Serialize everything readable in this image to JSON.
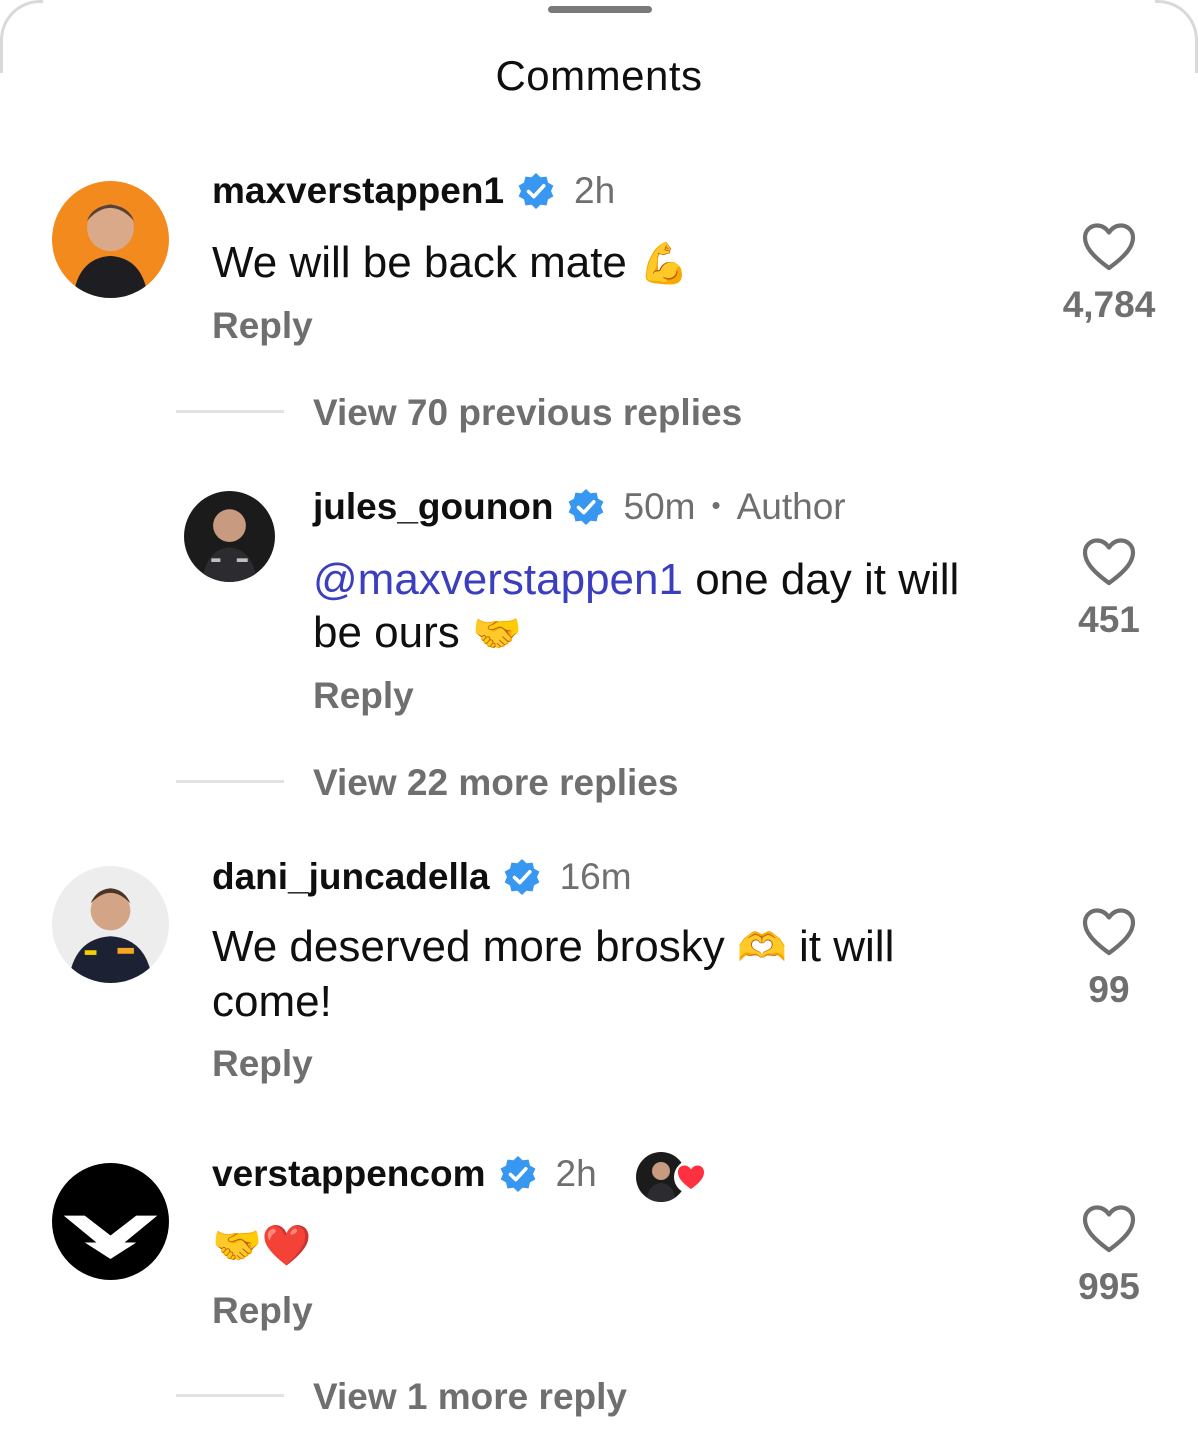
{
  "sheet": {
    "title": "Comments"
  },
  "comments": [
    {
      "username": "maxverstappen1",
      "time": "2h",
      "text": "We will be back mate",
      "emoji": "💪",
      "reply_label": "Reply",
      "likes": "4,784"
    },
    {
      "username": "jules_gounon",
      "time": "50m",
      "separator": "•",
      "author_tag": "Author",
      "mention": "@maxverstappen1",
      "text": "one day it will be ours",
      "emoji": "🤝",
      "reply_label": "Reply",
      "likes": "451"
    },
    {
      "username": "dani_juncadella",
      "time": "16m",
      "text_before": "We deserved more brosky",
      "emoji": "🫶",
      "text_after": "it will come!",
      "reply_label": "Reply",
      "likes": "99"
    },
    {
      "username": "verstappencom",
      "time": "2h",
      "emoji": "🤝❤️",
      "reply_label": "Reply",
      "likes": "995"
    }
  ],
  "thread_links": {
    "view_previous": "View 70 previous replies",
    "view_more": "View 22 more replies",
    "view_one_more": "View 1 more reply"
  },
  "colors": {
    "verified": "#3897f0",
    "mention": "#3b3fbf",
    "secondary_text": "#6f6f6f",
    "liked_heart": "#ff3040"
  },
  "icons": [
    "verified-badge-icon",
    "heart-outline-icon",
    "red-heart-icon"
  ]
}
